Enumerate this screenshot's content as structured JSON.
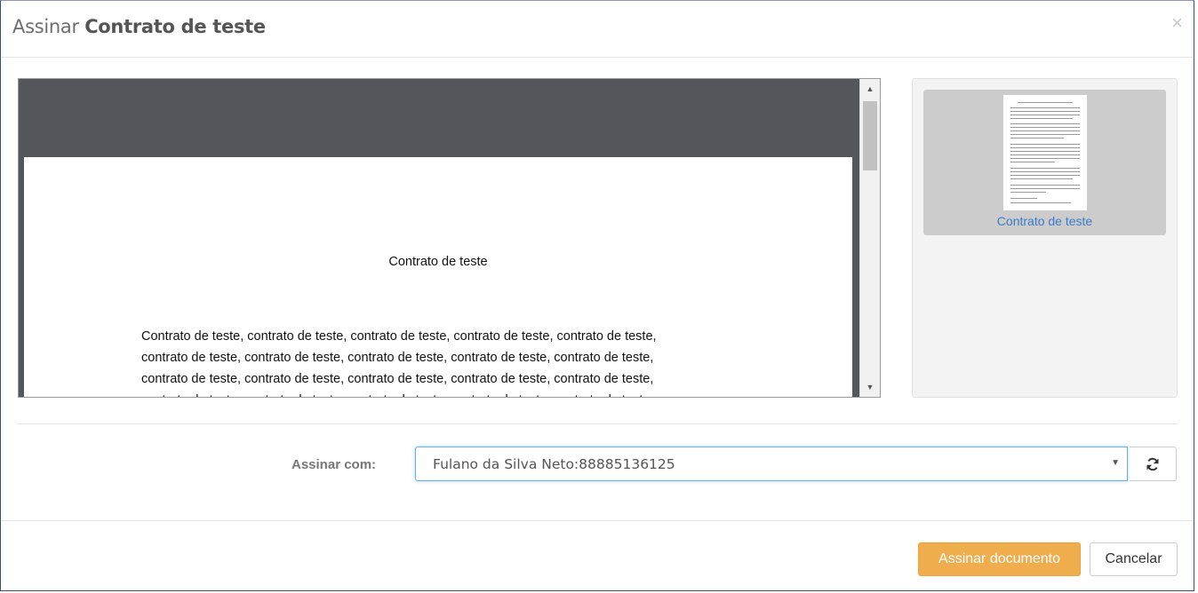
{
  "header": {
    "title_prefix": "Assinar",
    "title_document": "Contrato de teste",
    "close_symbol": "×"
  },
  "viewer": {
    "page_title": "Contrato de teste",
    "body_lines": [
      "Contrato de teste, contrato de teste, contrato de teste, contrato de teste, contrato de teste,",
      "contrato de teste, contrato de teste, contrato de teste, contrato de teste, contrato de teste,",
      "contrato de teste, contrato de teste, contrato de teste, contrato de teste, contrato de teste,",
      "contrato de teste, contrato de teste, contrato de teste, contrato de teste, contrato de teste,"
    ],
    "scroll_up_symbol": "▲",
    "scroll_down_symbol": "▼"
  },
  "thumbnails": [
    {
      "label": "Contrato de teste"
    }
  ],
  "form": {
    "sign_with_label": "Assinar com:",
    "certificate_selected": "Fulano da Silva Neto:88885136125",
    "caret_symbol": "▼",
    "refresh_icon": "refresh-icon"
  },
  "footer": {
    "sign_button_label": "Assinar documento",
    "cancel_button_label": "Cancelar"
  },
  "colors": {
    "primary_button": "#f0ad4e",
    "link": "#3a7bc8",
    "viewer_background": "#53565a",
    "focus_border": "#66afe9"
  }
}
